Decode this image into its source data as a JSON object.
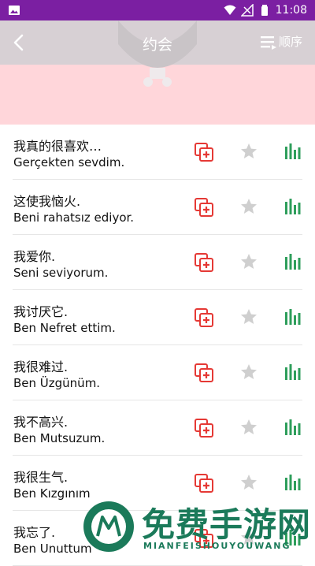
{
  "status_bar": {
    "time": "11:08"
  },
  "header": {
    "title": "约会",
    "order_label": "顺序"
  },
  "phrases": [
    {
      "zh": "我真的很喜欢…",
      "tr": "Gerçekten sevdim."
    },
    {
      "zh": "这使我恼火.",
      "tr": "Beni rahatsız ediyor."
    },
    {
      "zh": "我爱你.",
      "tr": "Seni seviyorum."
    },
    {
      "zh": "我讨厌它.",
      "tr": "Ben Nefret ettim."
    },
    {
      "zh": "我很难过.",
      "tr": "Ben Üzgünüm."
    },
    {
      "zh": "我不高兴.",
      "tr": "Ben Mutsuzum."
    },
    {
      "zh": "我很生气.",
      "tr": "Ben Kızgınım"
    },
    {
      "zh": "我忘了.",
      "tr": "Ben Unuttum"
    }
  ],
  "watermark": {
    "title": "免费手游网",
    "subtitle": "MIANFEISHOUYOUWANG"
  },
  "colors": {
    "status_bar": "#7b1fa2",
    "header_bg": "#ffd6da",
    "copy_icon": "#e53935",
    "star_icon": "#cfcfcf",
    "bars_icon": "#2e9e5b"
  },
  "icons": {
    "back": "chevron-left-icon",
    "order": "sort-list-icon",
    "copy": "copy-add-icon",
    "star": "star-icon",
    "bars": "audio-bars-icon"
  }
}
